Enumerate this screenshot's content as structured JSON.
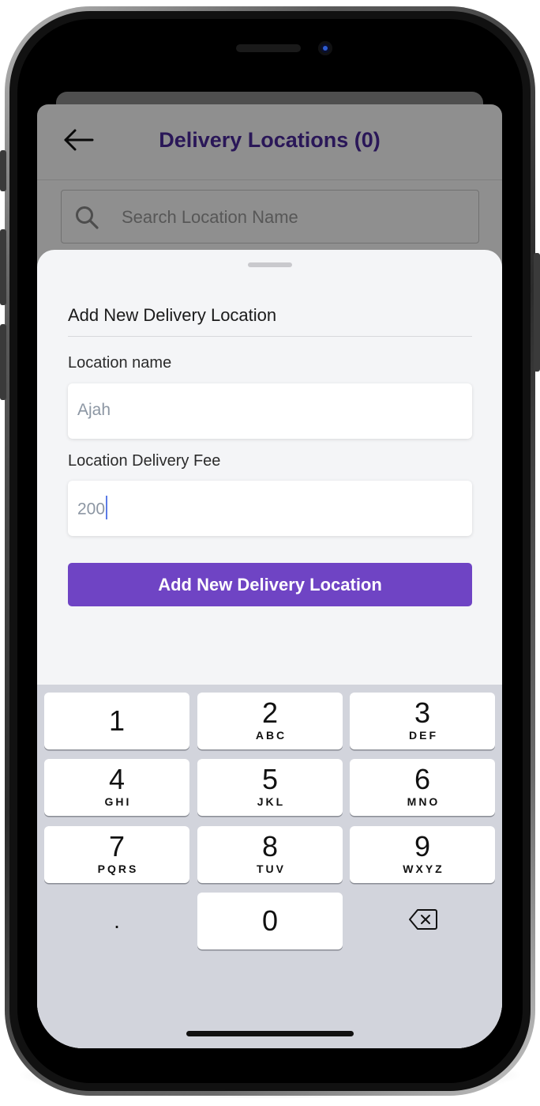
{
  "header": {
    "title": "Delivery Locations (0)"
  },
  "search": {
    "placeholder": "Search Location Name"
  },
  "sheet": {
    "title": "Add New Delivery Location",
    "location_name_label": "Location name",
    "location_name_value": "Ajah",
    "fee_label": "Location Delivery Fee",
    "fee_value": "200",
    "submit_label": "Add New Delivery Location"
  },
  "keyboard": {
    "keys": [
      {
        "digit": "1",
        "letters": ""
      },
      {
        "digit": "2",
        "letters": "ABC"
      },
      {
        "digit": "3",
        "letters": "DEF"
      },
      {
        "digit": "4",
        "letters": "GHI"
      },
      {
        "digit": "5",
        "letters": "JKL"
      },
      {
        "digit": "6",
        "letters": "MNO"
      },
      {
        "digit": "7",
        "letters": "PQRS"
      },
      {
        "digit": "8",
        "letters": "TUV"
      },
      {
        "digit": "9",
        "letters": "WXYZ"
      }
    ],
    "dot": ".",
    "zero": "0"
  },
  "icons": {
    "back": "arrow-left-icon",
    "search": "search-icon",
    "backspace": "backspace-icon"
  },
  "colors": {
    "accent": "#6f44c4",
    "title": "#4b2a9e",
    "caret": "#5b7be6"
  }
}
